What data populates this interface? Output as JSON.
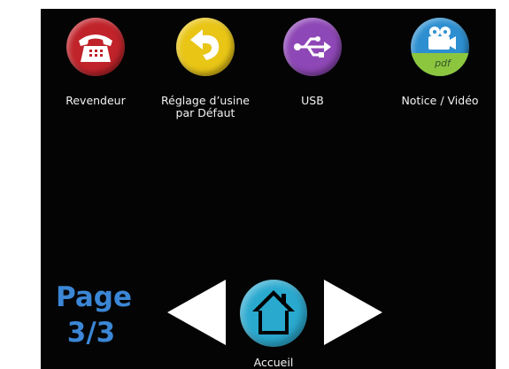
{
  "menu": {
    "items": [
      {
        "label": "Revendeur",
        "icon": "telephone-icon",
        "color": "#c0232a"
      },
      {
        "label_line1": "Réglage d’usine",
        "label_line2": "par Défaut",
        "icon": "undo-arrow-icon",
        "color": "#e9c516"
      },
      {
        "label": "USB",
        "icon": "usb-icon",
        "color": "#8e47b6"
      },
      {
        "label": "Notice / Vidéo",
        "icon": "video-camera-pdf-icon",
        "color": "#2d8fd0",
        "icon_text": "pdf"
      }
    ]
  },
  "pagination": {
    "label": "Page",
    "current": "3/3"
  },
  "navigation": {
    "home_label": "Accueil",
    "home_icon": "home-icon",
    "prev_icon": "arrow-left-icon",
    "next_icon": "arrow-right-icon"
  },
  "colors": {
    "background": "#040404",
    "page_indicator": "#3b86d6",
    "home_button": "#2aa9cf",
    "arrows": "#ffffff"
  }
}
